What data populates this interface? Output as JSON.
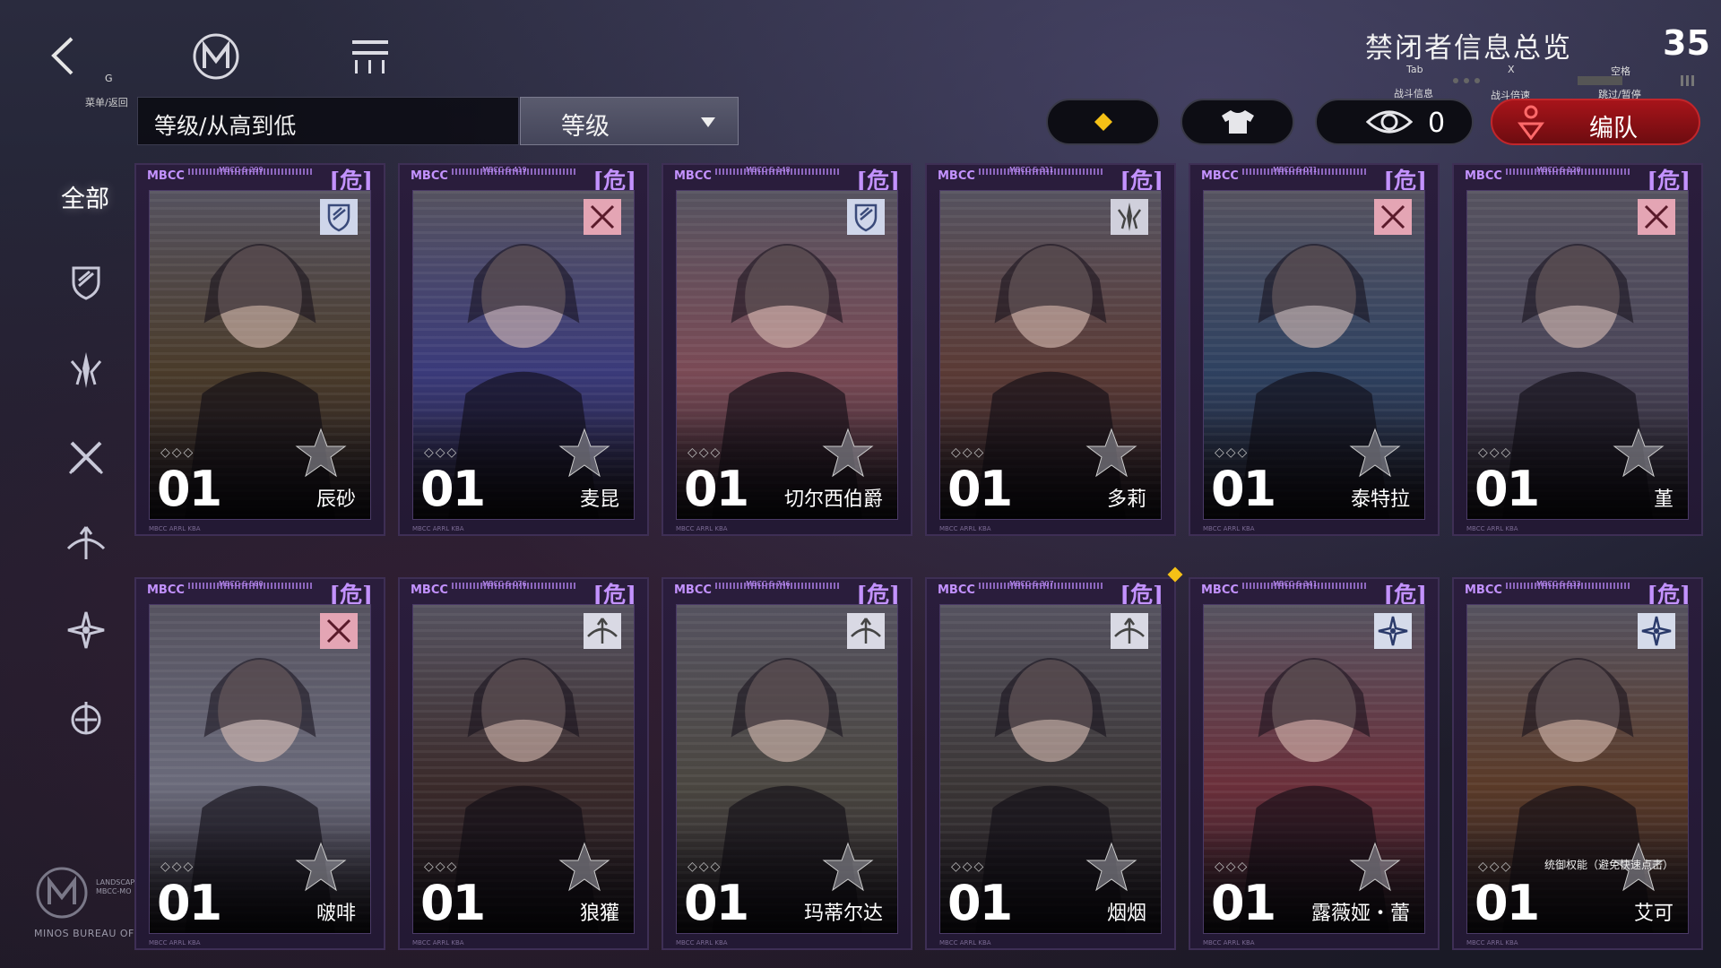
{
  "header": {
    "back_key": "G",
    "menu_label": "菜单/返回",
    "title": "禁闭者信息总览",
    "count": "35"
  },
  "sort": {
    "field_value": "等级/从高到低",
    "select_value": "等级"
  },
  "controls": {
    "combat_info_key": "Tab",
    "combat_info_label": "战斗信息",
    "speed_key": "X",
    "speed_label": "战斗倍速",
    "skip_key": "空格",
    "skip_label": "跳过/暂停",
    "eye_value": "0",
    "team_label": "编队",
    "colors": {
      "team": "#a7141a",
      "accent": "#c392ff",
      "diamond": "#f5c116"
    }
  },
  "sidebar": {
    "all_label": "全部",
    "filters": [
      "defender-icon",
      "striker-icon",
      "breaker-icon",
      "sniper-icon",
      "mage-icon",
      "support-icon"
    ]
  },
  "corner": {
    "org": "MINOS BUREAU OF C",
    "small_1": "LANDSCAP",
    "small_2": "MBCC-MO"
  },
  "cards": [
    {
      "code": "MBCC-S-299",
      "name": "辰砂",
      "level": "01",
      "class": "defender-icon",
      "tint": "#4a3b2a"
    },
    {
      "code": "MBCC-S-419",
      "name": "麦昆",
      "level": "01",
      "class": "breaker-icon",
      "tint": "#3a3a7a"
    },
    {
      "code": "MBCC-S-148",
      "name": "切尔西伯爵",
      "level": "01",
      "class": "defender-icon",
      "tint": "#7a4a55"
    },
    {
      "code": "MBCC-S-311",
      "name": "多莉",
      "level": "01",
      "class": "striker-icon",
      "tint": "#5a3a35"
    },
    {
      "code": "MBCC-S-071",
      "name": "泰特拉",
      "level": "01",
      "class": "breaker-icon",
      "tint": "#2e4160"
    },
    {
      "code": "MBCC-S-120",
      "name": "堇",
      "level": "01",
      "class": "breaker-icon",
      "tint": "#4a4558"
    },
    {
      "code": "MBCC-S-580",
      "name": "啵啡",
      "level": "01",
      "class": "breaker-icon",
      "tint": "#6a6a7a"
    },
    {
      "code": "MBCC-S-076",
      "name": "狼獾",
      "level": "01",
      "class": "sniper-icon",
      "tint": "#3a2a2a"
    },
    {
      "code": "MBCC-S-746",
      "name": "玛蒂尔达",
      "level": "01",
      "class": "sniper-icon",
      "tint": "#4a4640"
    },
    {
      "code": "MBCC-S-307",
      "name": "烟烟",
      "level": "01",
      "class": "sniper-icon",
      "tint": "#3a3535"
    },
    {
      "code": "MBCC-S-341",
      "name": "露薇娅・蕾",
      "level": "01",
      "class": "mage-icon",
      "tint": "#6a2f3a"
    },
    {
      "code": "MBCC-S-533",
      "name": "艾可",
      "level": "01",
      "class": "mage-icon",
      "tint": "#5a3a28"
    }
  ],
  "card_common": {
    "brand": "MBCC",
    "danger": "[危]",
    "sub": "MINOS BUREAU OF CRISIS CONTROL",
    "foot": "MBCC ARRL KBA",
    "side": "ERO RX"
  },
  "tooltip": "统御权能（避免快速点击）"
}
